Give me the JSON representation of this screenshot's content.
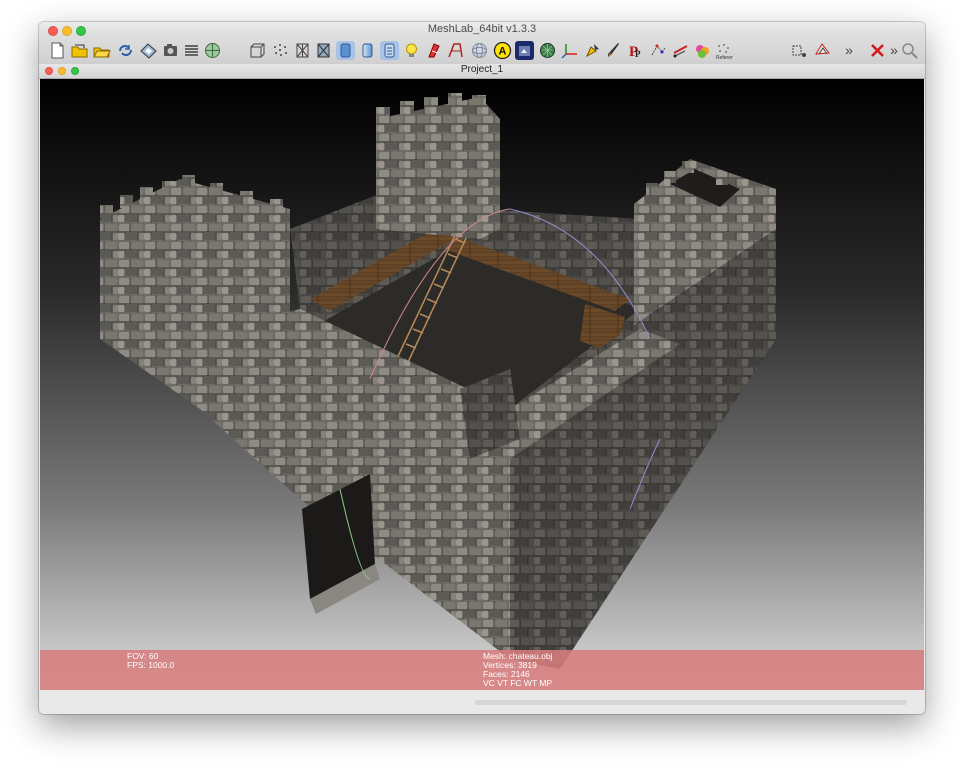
{
  "window": {
    "title": "MeshLab_64bit v1.3.3",
    "subwindow_title": "Project_1"
  },
  "toolbar": {
    "overflow_label_1": "»",
    "overflow_label_2": "»"
  },
  "info": {
    "fov": "FOV: 60",
    "fps": "FPS:  1000.0",
    "mesh": "Mesh: chateau.obj",
    "vertices": "Vertices: 3819",
    "faces": "Faces: 2146",
    "flags": "VC VT FC WT MP"
  }
}
